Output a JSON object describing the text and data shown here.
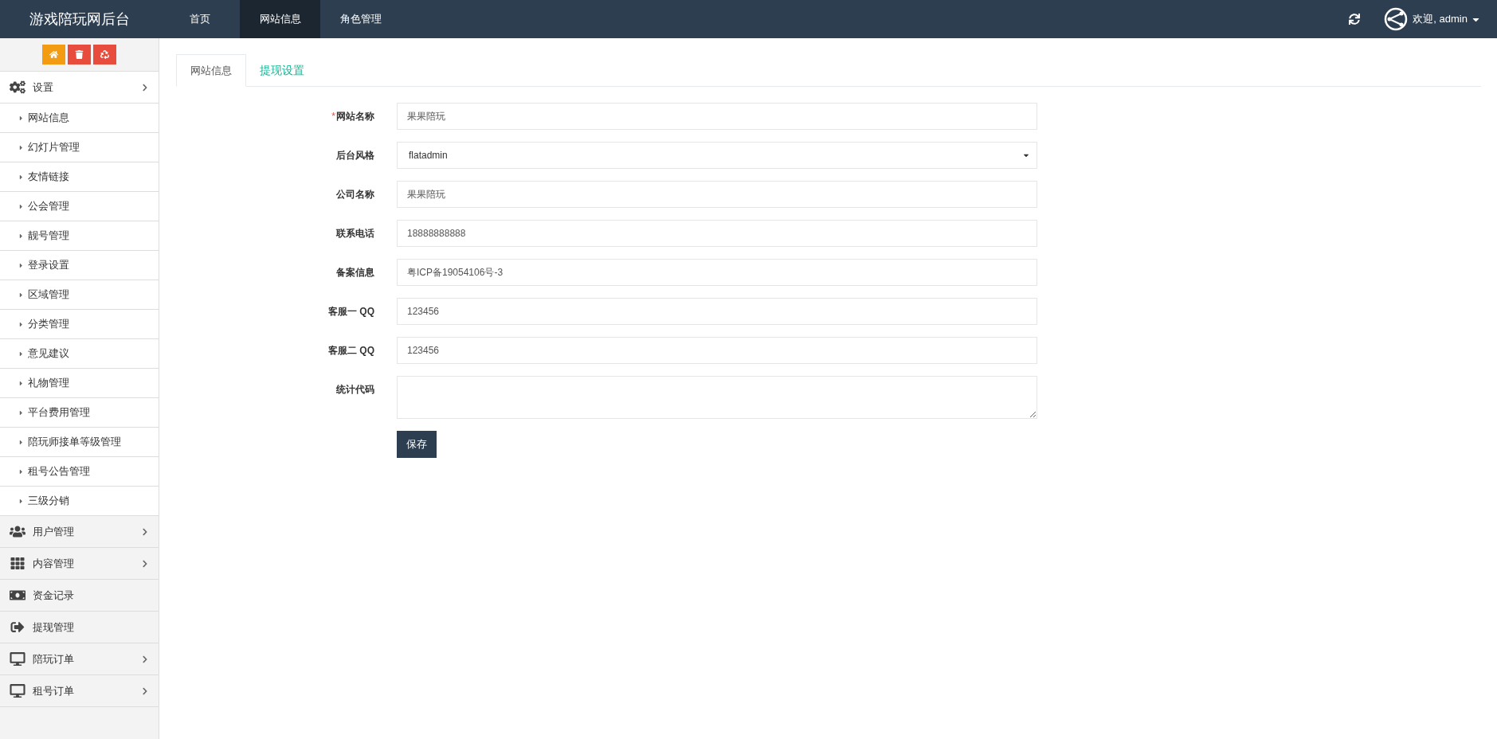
{
  "brand": "游戏陪玩网后台",
  "top_nav": [
    {
      "label": "首页",
      "selected": false
    },
    {
      "label": "网站信息",
      "selected": true
    },
    {
      "label": "角色管理",
      "selected": false
    }
  ],
  "user": {
    "greeting": "欢迎, admin"
  },
  "sidebar": {
    "tools": [
      {
        "kind": "home",
        "color": "#f39c12"
      },
      {
        "kind": "trash",
        "color": "#e74c3c"
      },
      {
        "kind": "recycle",
        "color": "#e74c3c"
      }
    ],
    "items": [
      {
        "label": "设置",
        "kind": "gears",
        "expanded": true,
        "has_children": true,
        "children": [
          {
            "label": "网站信息"
          },
          {
            "label": "幻灯片管理"
          },
          {
            "label": "友情链接"
          },
          {
            "label": "公会管理"
          },
          {
            "label": "靓号管理"
          },
          {
            "label": "登录设置"
          },
          {
            "label": "区域管理"
          },
          {
            "label": "分类管理"
          },
          {
            "label": "意见建议"
          },
          {
            "label": "礼物管理"
          },
          {
            "label": "平台费用管理"
          },
          {
            "label": "陪玩师接单等级管理"
          },
          {
            "label": "租号公告管理"
          },
          {
            "label": "三级分销"
          }
        ]
      },
      {
        "label": "用户管理",
        "kind": "users",
        "expanded": false,
        "has_children": true
      },
      {
        "label": "内容管理",
        "kind": "grid",
        "expanded": false,
        "has_children": true
      },
      {
        "label": "资金记录",
        "kind": "money",
        "expanded": false,
        "has_children": false
      },
      {
        "label": "提现管理",
        "kind": "signout",
        "expanded": false,
        "has_children": false
      },
      {
        "label": "陪玩订单",
        "kind": "desktop",
        "expanded": false,
        "has_children": true
      },
      {
        "label": "租号订单",
        "kind": "desktop",
        "expanded": false,
        "has_children": true
      }
    ]
  },
  "tabs": [
    {
      "label": "网站信息",
      "selected": true
    },
    {
      "label": "提现设置",
      "selected": false
    }
  ],
  "form": {
    "fields": [
      {
        "label": "网站名称",
        "required": true,
        "kind": "text",
        "value": "果果陪玩"
      },
      {
        "label": "后台风格",
        "required": false,
        "kind": "select",
        "value": "flatadmin"
      },
      {
        "label": "公司名称",
        "required": false,
        "kind": "text",
        "value": "果果陪玩"
      },
      {
        "label": "联系电话",
        "required": false,
        "kind": "text",
        "value": "18888888888"
      },
      {
        "label": "备案信息",
        "required": false,
        "kind": "text",
        "value": "粤ICP备19054106号-3"
      },
      {
        "label": "客服一 QQ",
        "required": false,
        "kind": "text",
        "value": "123456"
      },
      {
        "label": "客服二 QQ",
        "required": false,
        "kind": "text",
        "value": "123456"
      },
      {
        "label": "统计代码",
        "required": false,
        "kind": "textarea"
      }
    ],
    "required_mark": "*",
    "submit": "保存"
  }
}
